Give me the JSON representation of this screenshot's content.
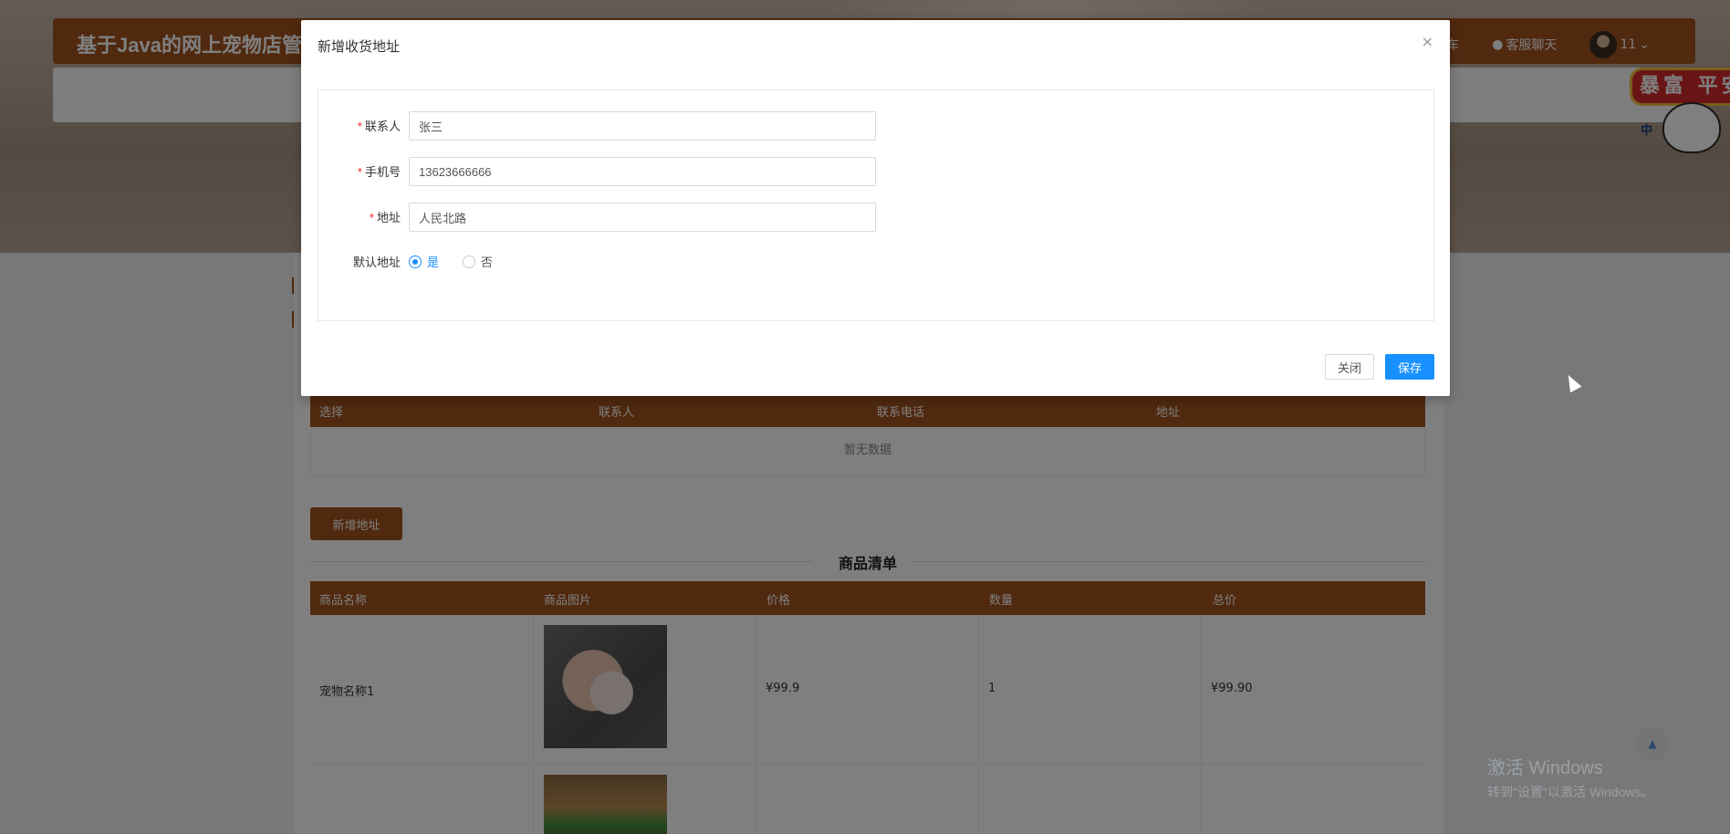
{
  "header": {
    "site_title": "基于Java的网上宠物店管理",
    "cart_link": "购物车",
    "chat_link": "客服聊天",
    "username": "11"
  },
  "address_table": {
    "columns": [
      "选择",
      "联系人",
      "联系电话",
      "地址"
    ],
    "empty_text": "暂无数据"
  },
  "add_address_button": "新增地址",
  "product_list": {
    "title": "商品清单",
    "columns": [
      "商品名称",
      "商品图片",
      "价格",
      "数量",
      "总价"
    ],
    "rows": [
      {
        "name": "宠物名称1",
        "price": "¥99.9",
        "qty": "1",
        "total": "¥99.90"
      }
    ]
  },
  "sticker": {
    "text": "暴富 平安",
    "corner": "中"
  },
  "watermark": {
    "line1": "激活 Windows",
    "line2": "转到\"设置\"以激活 Windows。"
  },
  "modal": {
    "title": "新增收货地址",
    "close_glyph": "×",
    "fields": {
      "contact": {
        "label": "联系人",
        "value": "张三",
        "required": "*"
      },
      "phone": {
        "label": "手机号",
        "value": "13623666666",
        "required": "*"
      },
      "address": {
        "label": "地址",
        "value": "人民北路",
        "required": "*"
      },
      "default": {
        "label": "默认地址",
        "options": [
          "是",
          "否"
        ],
        "selected": "是"
      }
    },
    "buttons": {
      "close": "关闭",
      "save": "保存"
    }
  },
  "colors": {
    "brand": "#a0521e",
    "primary": "#1890ff",
    "required": "#f5222d"
  }
}
